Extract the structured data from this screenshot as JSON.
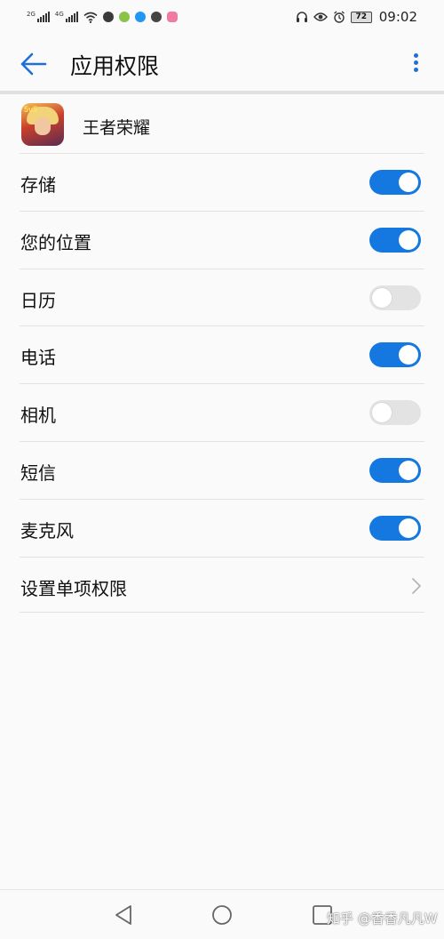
{
  "status_bar": {
    "net1": "2G",
    "net2": "4G",
    "battery": "72",
    "time": "09:02",
    "left_icons": [
      "signal-icon",
      "signal-icon",
      "wifi-icon",
      "app-icon",
      "app-icon",
      "zhihu-icon",
      "wechat-icon",
      "app-icon"
    ],
    "right_icons": [
      "headphone-icon",
      "eye-icon",
      "alarm-icon",
      "battery-icon"
    ]
  },
  "header": {
    "title": "应用权限",
    "back_icon": "arrow-left-icon",
    "menu_icon": "more-vertical-icon",
    "accent": "#1e6fd9"
  },
  "app": {
    "name": "王者荣耀",
    "icon_tag": "5v5"
  },
  "permissions": [
    {
      "label": "存储",
      "enabled": true
    },
    {
      "label": "您的位置",
      "enabled": true
    },
    {
      "label": "日历",
      "enabled": false
    },
    {
      "label": "电话",
      "enabled": true
    },
    {
      "label": "相机",
      "enabled": false
    },
    {
      "label": "短信",
      "enabled": true
    },
    {
      "label": "麦克风",
      "enabled": true
    }
  ],
  "single_permission": {
    "label": "设置单项权限",
    "icon": "chevron-right-icon"
  },
  "colors": {
    "switch_on": "#1478e0",
    "switch_off": "#e3e3e3"
  },
  "nav": {
    "icons": [
      "triangle-back-icon",
      "circle-home-icon",
      "square-recent-icon"
    ]
  },
  "watermark": "知乎 @香香凡凡W"
}
